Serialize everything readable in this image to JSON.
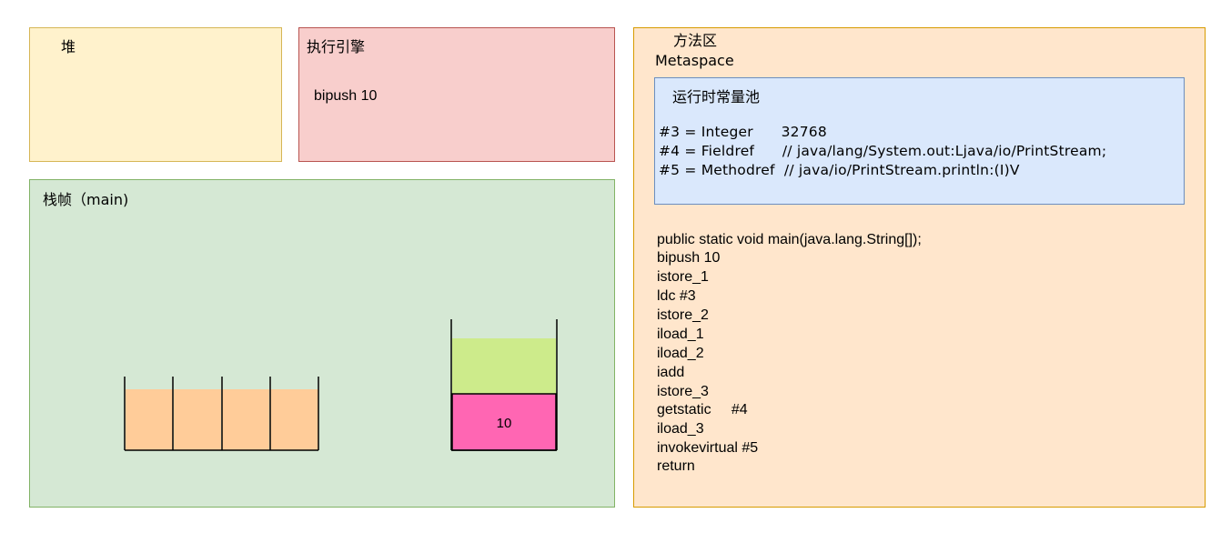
{
  "heap": {
    "title": "堆"
  },
  "engine": {
    "title": "执行引擎",
    "current_instruction": "bipush 10"
  },
  "frame": {
    "title": "栈帧（main)",
    "local_variables": [
      "",
      "",
      "",
      ""
    ],
    "operand_stack": [
      "10",
      ""
    ]
  },
  "method_area": {
    "title": "方法区",
    "subtitle": "Metaspace",
    "constant_pool": {
      "title": "运行时常量池",
      "entries": [
        "#3 = Integer      32768",
        "#4 = Fieldref      // java/lang/System.out:Ljava/io/PrintStream;",
        "#5 = Methodref  // java/io/PrintStream.println:(I)V"
      ]
    },
    "bytecode": [
      "public static void main(java.lang.String[]);",
      "bipush 10",
      "istore_1",
      "ldc #3",
      "istore_2",
      "iload_1",
      "iload_2",
      "iadd",
      "istore_3",
      "getstatic     #4",
      "iload_3",
      "invokevirtual #5",
      "return"
    ]
  },
  "colors": {
    "heap_fill": "#fff2cc",
    "engine_fill": "#f8cecc",
    "frame_fill": "#d5e8d4",
    "method_fill": "#ffe6cc",
    "pool_fill": "#dae8fc",
    "local_slot_fill": "#ffcc99",
    "stack_top_fill": "#cdeb8b",
    "stack_value_fill": "#ff66b3"
  }
}
